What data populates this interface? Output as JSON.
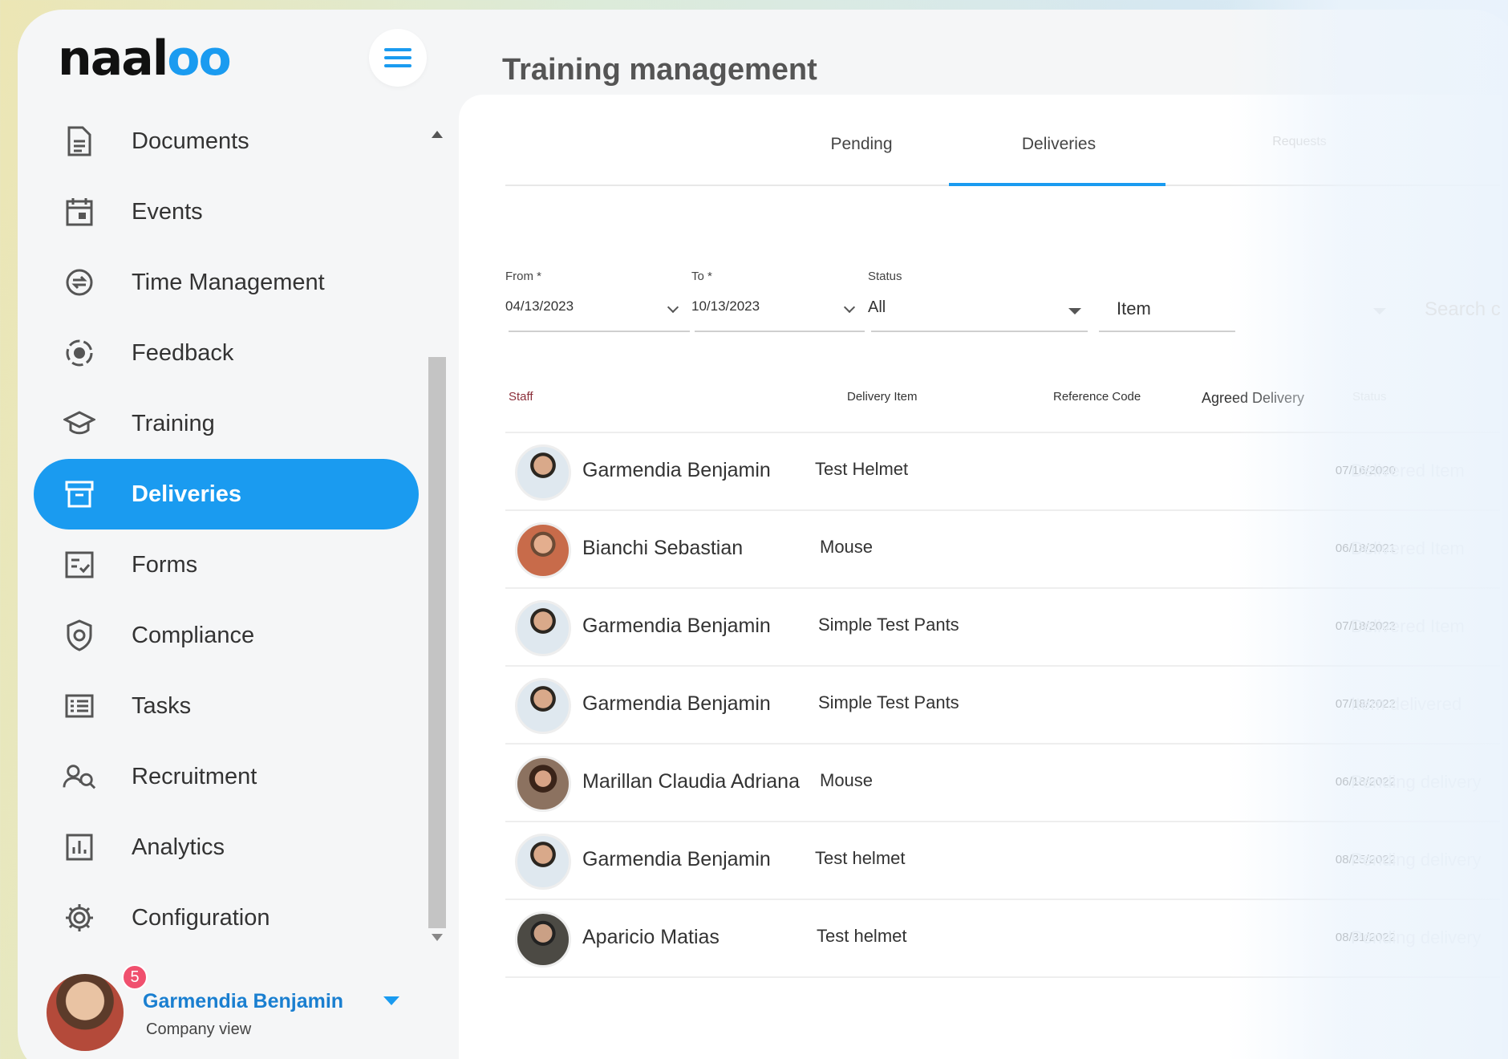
{
  "app": {
    "logo_text": "naal",
    "logo_suffix": "oo"
  },
  "page_title": "Training management",
  "sidebar": {
    "items": [
      {
        "label": "Documents",
        "icon": "document-icon"
      },
      {
        "label": "Events",
        "icon": "calendar-icon"
      },
      {
        "label": "Time Management",
        "icon": "time-management-icon"
      },
      {
        "label": "Feedback",
        "icon": "feedback-icon"
      },
      {
        "label": "Training",
        "icon": "graduation-cap-icon"
      },
      {
        "label": "Deliveries",
        "icon": "archive-box-icon",
        "active": true
      },
      {
        "label": "Forms",
        "icon": "form-icon"
      },
      {
        "label": "Compliance",
        "icon": "shield-icon"
      },
      {
        "label": "Tasks",
        "icon": "task-list-icon"
      },
      {
        "label": "Recruitment",
        "icon": "recruitment-icon"
      },
      {
        "label": "Analytics",
        "icon": "bar-chart-icon"
      },
      {
        "label": "Configuration",
        "icon": "gear-icon"
      }
    ]
  },
  "user": {
    "name": "Garmendia Benjamin",
    "view": "Company view",
    "notifications": "5"
  },
  "tabs": [
    {
      "label": "Pending"
    },
    {
      "label": "Deliveries",
      "active": true
    },
    {
      "label": "Requests"
    }
  ],
  "filters": {
    "from": {
      "label": "From *",
      "value": "04/13/2023"
    },
    "to": {
      "label": "To *",
      "value": "10/13/2023"
    },
    "status": {
      "label": "Status",
      "value": "All"
    },
    "item": {
      "value": "Item"
    },
    "search": {
      "placeholder": "Search c"
    }
  },
  "table": {
    "columns": [
      "Staff",
      "Delivery Item",
      "Reference Code",
      "Agreed Delivery",
      "Status"
    ],
    "rows": [
      {
        "staff": "Garmendia Benjamin",
        "item": "Test Helmet",
        "date": "07/16/2020",
        "status": "Delivered Item"
      },
      {
        "staff": "Bianchi Sebastian",
        "item": "Mouse",
        "date": "06/18/2021",
        "status": "Delivered Item"
      },
      {
        "staff": "Garmendia Benjamin",
        "item": "Simple Test Pants",
        "date": "07/18/2022",
        "status": "Delivered Item"
      },
      {
        "staff": "Garmendia Benjamin",
        "item": "Simple Test Pants",
        "date": "07/18/2022",
        "status": "Item delivered"
      },
      {
        "staff": "Marillan Claudia Adriana",
        "item": "Mouse",
        "date": "06/18/2022",
        "status": "Pending delivery"
      },
      {
        "staff": "Garmendia Benjamin",
        "item": "Test helmet",
        "date": "08/25/2022",
        "status": "Pending delivery"
      },
      {
        "staff": "Aparicio Matias",
        "item": "Test helmet",
        "date": "08/31/2022",
        "status": "Pending delivery"
      }
    ]
  },
  "colors": {
    "accent": "#1a9bf0",
    "badge": "#f0506e",
    "staff_header": "#8b2f3a"
  }
}
